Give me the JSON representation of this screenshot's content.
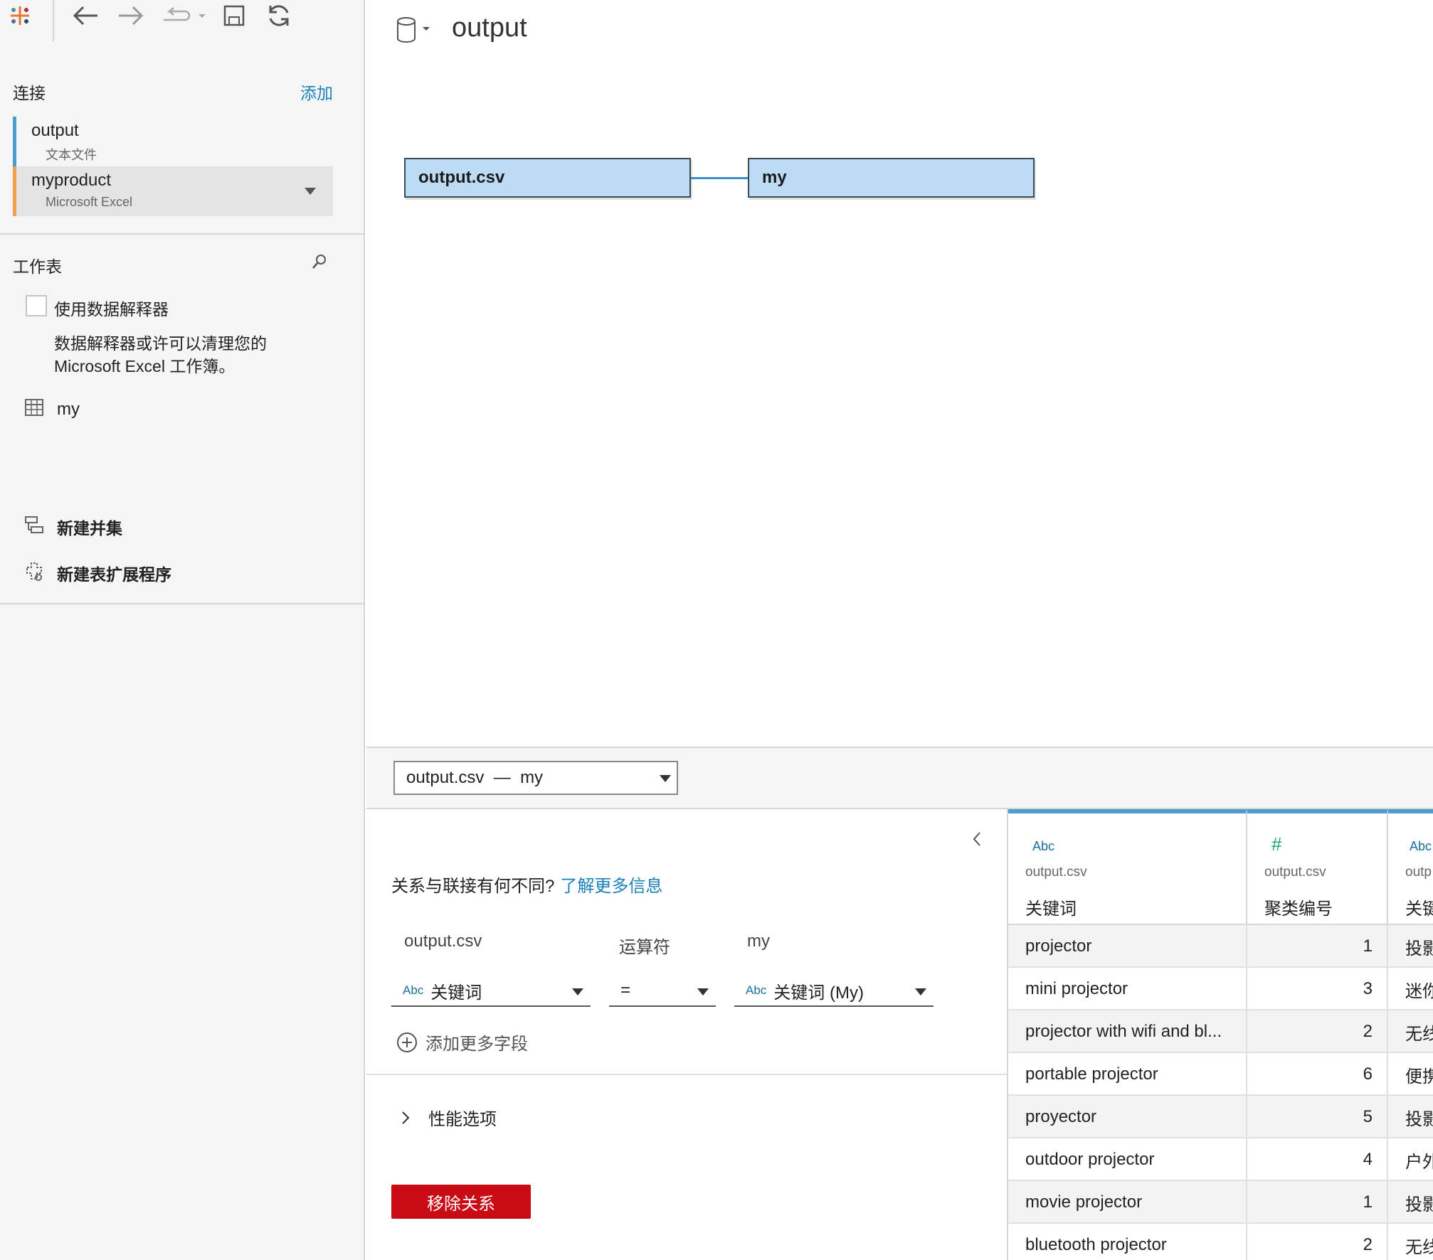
{
  "sidebar": {
    "connections_title": "连接",
    "add_label": "添加",
    "connections": [
      {
        "name": "output",
        "type": "文本文件",
        "color": "#4d9ccc"
      },
      {
        "name": "myproduct",
        "type": "Microsoft Excel",
        "color": "#f0a050"
      }
    ],
    "sheets_title": "工作表",
    "interpreter_label": "使用数据解释器",
    "interpreter_desc_1": "数据解释器或许可以清理您的",
    "interpreter_desc_2": "Microsoft Excel 工作簿。",
    "sheets": [
      {
        "name": "my"
      }
    ],
    "new_union": "新建并集",
    "new_extension": "新建表扩展程序"
  },
  "main": {
    "title": "output",
    "tables": [
      "output.csv",
      "my"
    ]
  },
  "relationship": {
    "selector": "output.csv  —  my",
    "help_text": "关系与联接有何不同?",
    "help_link": "了解更多信息",
    "left_table": "output.csv",
    "operator_label": "运算符",
    "right_table": "my",
    "left_field": "关键词",
    "operator": "=",
    "right_field": "关键词 (My)",
    "abc_tag": "Abc",
    "add_field": "添加更多字段",
    "performance": "性能选项",
    "remove": "移除关系"
  },
  "grid": {
    "columns": [
      {
        "type": "Abc",
        "source": "output.csv",
        "name": "关键词"
      },
      {
        "type": "#",
        "source": "output.csv",
        "name": "聚类编号"
      },
      {
        "type": "Abc",
        "source": "outp",
        "name": "关键"
      }
    ],
    "rows": [
      [
        "projector",
        "1",
        "投影"
      ],
      [
        "mini projector",
        "3",
        "迷你"
      ],
      [
        "projector with wifi and bl...",
        "2",
        "无线"
      ],
      [
        "portable projector",
        "6",
        "便携"
      ],
      [
        "proyector",
        "5",
        "投影"
      ],
      [
        "outdoor projector",
        "4",
        "户外"
      ],
      [
        "movie projector",
        "1",
        "投影"
      ],
      [
        "bluetooth projector",
        "2",
        "无线"
      ]
    ]
  }
}
